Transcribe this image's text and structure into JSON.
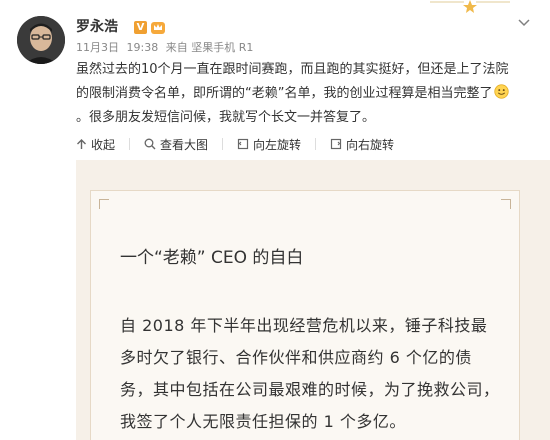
{
  "post": {
    "username": "罗永浩",
    "verified_badge": "V",
    "badges": [
      "verified-v-icon",
      "member-crown-icon"
    ],
    "meta": {
      "date": "11月3日",
      "time": "19:38",
      "source": "来自 坚果手机 R1"
    },
    "body_text": "虽然过去的10个月一直在跟时间赛跑，而且跑的其实挺好，但还是上了法院的限制消费令名单，即所谓的“老赖”名单，我的创业过程算是相当完整了",
    "body_emoji": "smiley-icon",
    "body_text_after": "。很多朋友发短信问候，我就写个长文一并答复了。"
  },
  "toolbar": {
    "collapse": "收起",
    "view_large": "查看大图",
    "rotate_left": "向左旋转",
    "rotate_right": "向右旋转"
  },
  "image_card": {
    "title": "一个“老赖” CEO 的自白",
    "body": "自 2018 年下半年出现经营危机以来，锤子科技最多时欠了银行、合作伙伴和供应商约 6 个亿的债务，其中包括在公司最艰难的时候，为了挽救公司，我签了个人无限责任担保的 1 个多亿。"
  },
  "colors": {
    "badge_orange": "#f0a031",
    "card_bg": "#f6f0e8",
    "meta_gray": "#888888"
  }
}
